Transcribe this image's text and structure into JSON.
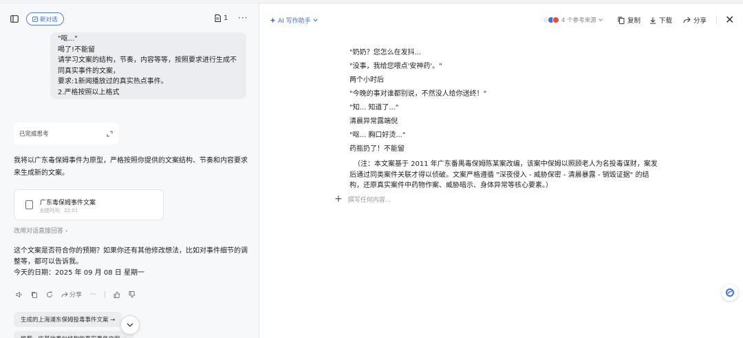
{
  "left": {
    "new_chat_label": "新对话",
    "doc_count": "1",
    "user_message": {
      "lines": [
        "\"呕...\"",
        "喝了!不能留",
        "请学习文案的结构，节奏，内容等等，按照要求进行生成不同真实事件的文案，",
        "要求:1新闻播放过的真实热点事件。",
        "2.严格按照以上格式"
      ]
    },
    "thinking_label": "已完成思考",
    "ai_intro": "我将以广东毒保姆事件为原型，严格按照你提供的文案结构、节奏和内容要求来生成新的文案。",
    "doc_card": {
      "title": "广东毒保姆事件文案",
      "time": "创建时间：22:01"
    },
    "switch_link": "改用对话直接回答",
    "ai_followup": [
      "这个文案是否符合你的预期？如果你还有其他修改想法，比如对事件细节的调整等，都可以告诉我。",
      "今天的日期：2025 年 09 月 08 日 星期一"
    ],
    "share_label": "分享",
    "suggestions": [
      "生成的上海浦东保姆投毒事件文案 →",
      "推荐一些其他类似结构的真实事件文案 →"
    ]
  },
  "right": {
    "ai_assist_label": "AI 写作助手",
    "refs_label": "4 个参考来源",
    "copy_label": "复制",
    "download_label": "下载",
    "share_label": "分享",
    "story_lines": [
      "\"奶奶？您怎么在发抖...",
      "\"没事，我给您喂点'安神药'。\"",
      "两个小时后",
      "\"今晚的事对谁都别说，不然没人给你送终！\"",
      "\"知... 知道了...\"",
      "清晨异常露端倪",
      "\"呕... 胸口好烫...\"",
      "药瓶扔了！不能留"
    ],
    "note": "（注：本文案基于 2011 年广东番禺毒保姆陈某案改编，该案中保姆以照顾老人为名投毒谋财，案发后通过同类案件关联才得以侦破。文案严格遵循 \"深夜侵入 - 威胁保密 - 清晨暴露 - 销毁证据\" 的结构，还原真实案件中药物作案、威胁暗示、身体异常等核心要素。）",
    "write_placeholder": "撰写任何内容..."
  },
  "colors": {
    "accent": "#3b6ff0"
  }
}
